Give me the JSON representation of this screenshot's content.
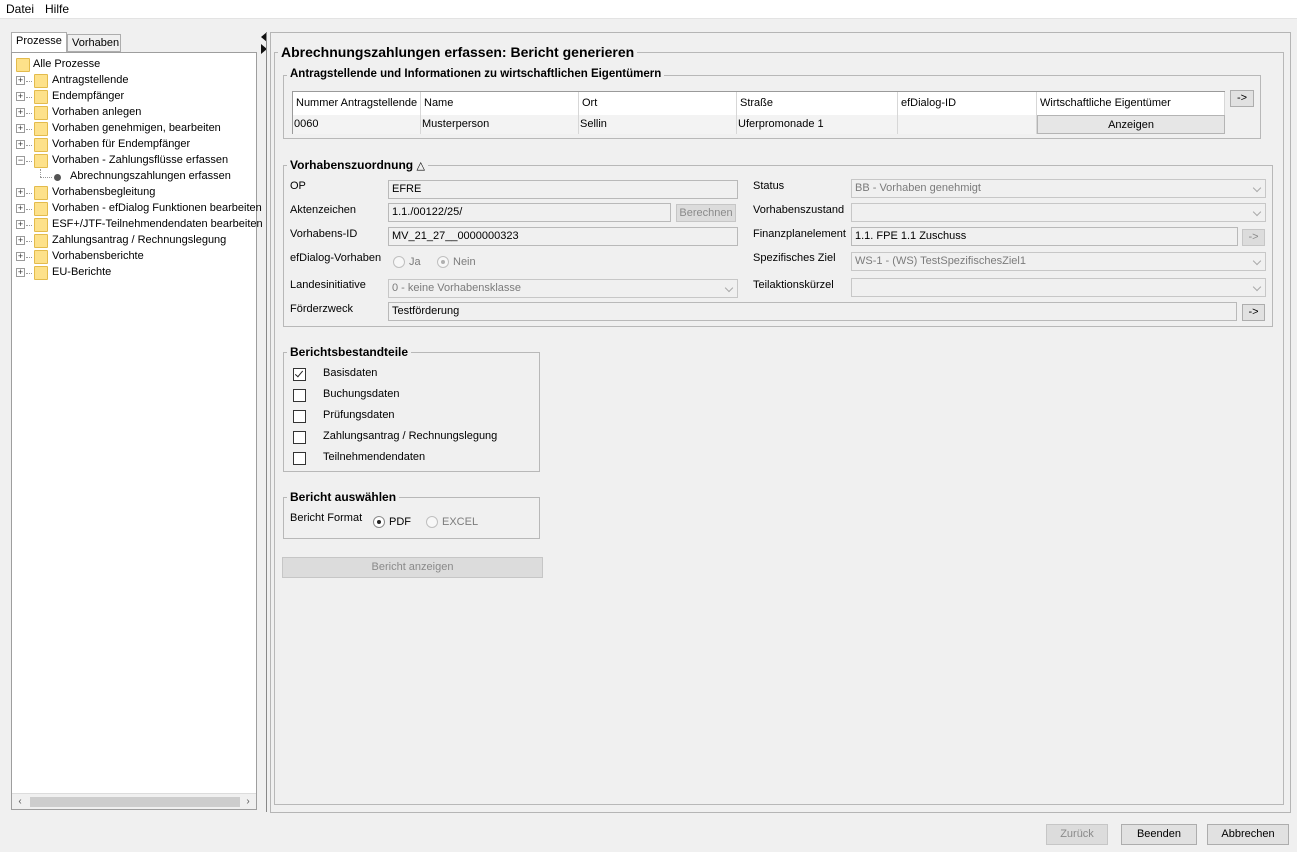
{
  "menu": {
    "file": "Datei",
    "help": "Hilfe"
  },
  "left_tabs": {
    "processes": "Prozesse",
    "projects": "Vorhaben"
  },
  "tree": {
    "root": "Alle Prozesse",
    "items": [
      {
        "label": "Antragstellende",
        "expanded": false
      },
      {
        "label": "Endempfänger",
        "expanded": false
      },
      {
        "label": "Vorhaben anlegen",
        "expanded": false
      },
      {
        "label": "Vorhaben genehmigen, bearbeiten",
        "expanded": false
      },
      {
        "label": "Vorhaben für Endempfänger",
        "expanded": false
      },
      {
        "label": "Vorhaben - Zahlungsflüsse erfassen",
        "expanded": true
      },
      {
        "label": "Abrechnungszahlungen erfassen",
        "leaf": true
      },
      {
        "label": "Vorhabensbegleitung",
        "expanded": false
      },
      {
        "label": "Vorhaben - efDialog Funktionen bearbeiten",
        "expanded": false
      },
      {
        "label": "ESF+/JTF-Teilnehmendendaten bearbeiten",
        "expanded": false
      },
      {
        "label": "Zahlungsantrag / Rechnungslegung",
        "expanded": false
      },
      {
        "label": "Vorhabensberichte",
        "expanded": false
      },
      {
        "label": "EU-Berichte",
        "expanded": false
      }
    ]
  },
  "main": {
    "title": "Abrechnungszahlungen erfassen: Bericht generieren",
    "applicants": {
      "title": "Antragstellende und Informationen zu wirtschaftlichen Eigentümern",
      "nav_button": "->",
      "columns": [
        "Nummer Antragstellende",
        "Name",
        "Ort",
        "Straße",
        "efDialog-ID",
        "Wirtschaftliche Eigentümer"
      ],
      "rows": [
        {
          "number": "0060",
          "name": "Musterperson",
          "city": "Sellin",
          "street": "Uferpromonade 1",
          "efdialog_id": "",
          "owners_button": "Anzeigen"
        }
      ]
    },
    "assignment": {
      "title": "Vorhabenszuordnung",
      "op_label": "OP",
      "op_value": "EFRE",
      "file_number_label": "Aktenzeichen",
      "file_number_value": "1.1./00122/25/",
      "calculate_button": "Berechnen",
      "project_id_label": "Vorhabens-ID",
      "project_id_value": "MV_21_27__0000000323",
      "efdialog_label": "efDialog-Vorhaben",
      "efdialog_yes": "Ja",
      "efdialog_no": "Nein",
      "efdialog_selected": "Nein",
      "state_initiative_label": "Landesinitiative",
      "state_initiative_value": "0 - keine Vorhabensklasse",
      "purpose_label": "Förderzweck",
      "purpose_value": "Testförderung",
      "purpose_nav": "->",
      "status_label": "Status",
      "status_value": "BB - Vorhaben genehmigt",
      "project_state_label": "Vorhabenszustand",
      "project_state_value": "",
      "finance_label": "Finanzplanelement",
      "finance_value": "1.1. FPE 1.1 Zuschuss",
      "finance_nav": "->",
      "objective_label": "Spezifisches Ziel",
      "objective_value": "WS-1 - (WS) TestSpezifischesZiel1",
      "action_label": "Teilaktionskürzel",
      "action_value": ""
    },
    "report_parts": {
      "title": "Berichtsbestandteile",
      "items": [
        {
          "label": "Basisdaten",
          "checked": true
        },
        {
          "label": "Buchungsdaten",
          "checked": false
        },
        {
          "label": "Prüfungsdaten",
          "checked": false
        },
        {
          "label": "Zahlungsantrag / Rechnungslegung",
          "checked": false
        },
        {
          "label": "Teilnehmendendaten",
          "checked": false
        }
      ]
    },
    "report_select": {
      "title": "Bericht auswählen",
      "format_label": "Bericht Format",
      "pdf": "PDF",
      "excel": "EXCEL",
      "selected": "PDF"
    },
    "show_report_button": "Bericht anzeigen"
  },
  "footer": {
    "back": "Zurück",
    "finish": "Beenden",
    "cancel": "Abbrechen"
  },
  "colors": {
    "folder": "#fde18a",
    "panel": "#f0f0f0",
    "border": "#b8b8b8"
  }
}
